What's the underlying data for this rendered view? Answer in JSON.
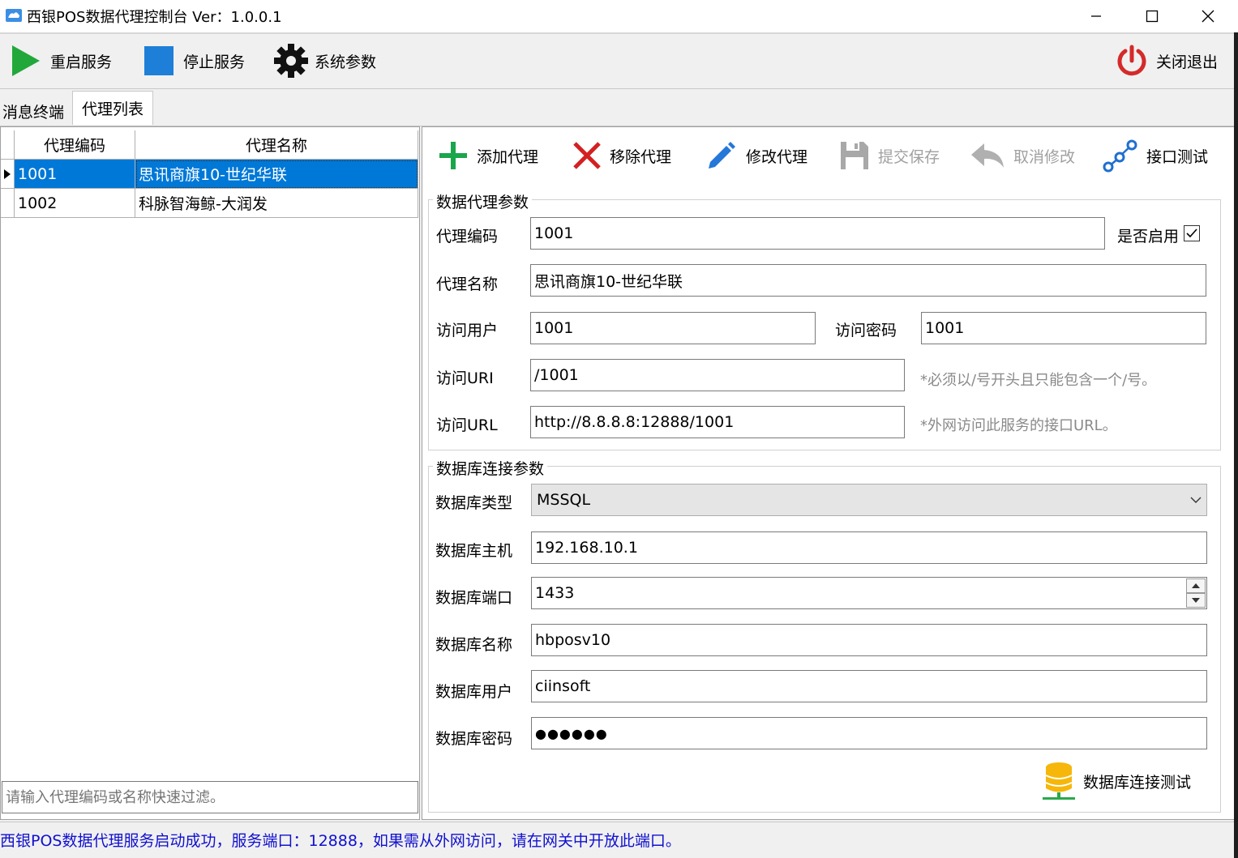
{
  "window": {
    "title": "西银POS数据代理控制台 Ver：1.0.0.1",
    "minimize": "—",
    "maximize": "☐",
    "close": "✕"
  },
  "toolbar": {
    "restart": "重启服务",
    "stop": "停止服务",
    "settings": "系统参数",
    "exit": "关闭退出"
  },
  "tabs": {
    "messages": "消息终端",
    "agents": "代理列表"
  },
  "grid": {
    "headers": [
      "代理编码",
      "代理名称"
    ],
    "rows": [
      {
        "code": "1001",
        "name": "思讯商旗10-世纪华联",
        "selected": true
      },
      {
        "code": "1002",
        "name": "科脉智海鲸-大润发",
        "selected": false
      }
    ],
    "filter_placeholder": "请输入代理编码或名称快速过滤。"
  },
  "actions": {
    "add": "添加代理",
    "remove": "移除代理",
    "edit": "修改代理",
    "save": "提交保存",
    "cancel": "取消修改",
    "test": "接口测试"
  },
  "agent_params": {
    "title": "数据代理参数",
    "code_label": "代理编码",
    "code": "1001",
    "enabled_label": "是否启用",
    "enabled": true,
    "name_label": "代理名称",
    "name": "思讯商旗10-世纪华联",
    "user_label": "访问用户",
    "user": "1001",
    "password_label": "访问密码",
    "password": "1001",
    "uri_label": "访问URI",
    "uri": "/1001",
    "uri_hint": "*必须以/号开头且只能包含一个/号。",
    "url_label": "访问URL",
    "url": "http://8.8.8.8:12888/1001",
    "url_hint": "*外网访问此服务的接口URL。"
  },
  "db_params": {
    "title": "数据库连接参数",
    "type_label": "数据库类型",
    "type": "MSSQL",
    "host_label": "数据库主机",
    "host": "192.168.10.1",
    "port_label": "数据库端口",
    "port": "1433",
    "dbname_label": "数据库名称",
    "dbname": "hbposv10",
    "dbuser_label": "数据库用户",
    "dbuser": "ciinsoft",
    "dbpass_label": "数据库密码",
    "dbpass": "●●●●●●",
    "test_button": "数据库连接测试"
  },
  "status": "西银POS数据代理服务启动成功，服务端口：12888，如果需从外网访问，请在网关中开放此端口。",
  "colors": {
    "accent": "#0078d7",
    "play_green": "#22a83a",
    "stop_blue": "#1e7fd8",
    "power_red": "#d42a2a",
    "add_green": "#1aa64a",
    "remove_red": "#d42020",
    "status_blue": "#1010d0"
  }
}
